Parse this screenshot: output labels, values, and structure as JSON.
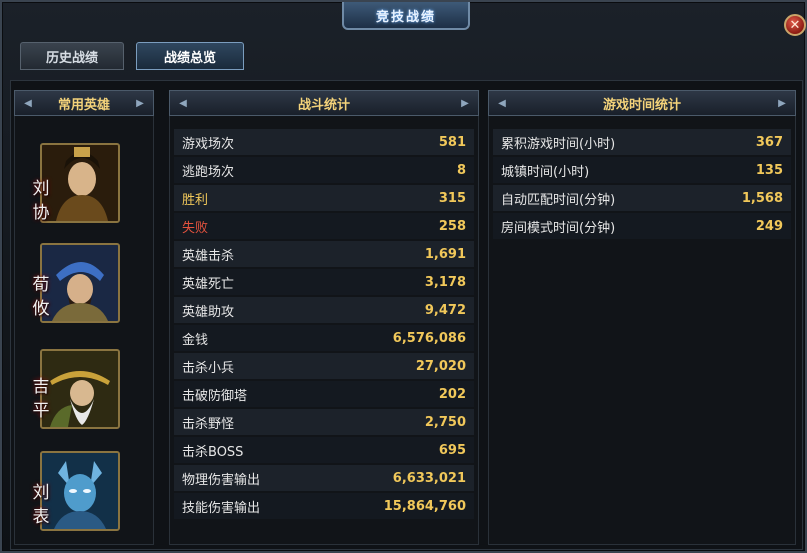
{
  "window": {
    "title": "竞技战绩",
    "close_label": "✕"
  },
  "tabs": [
    {
      "label": "历史战绩"
    },
    {
      "label": "战绩总览"
    }
  ],
  "heroes": {
    "header": "常用英雄",
    "items": [
      {
        "name": "刘协"
      },
      {
        "name": "荀攸"
      },
      {
        "name": "吉平"
      },
      {
        "name": "刘表"
      }
    ]
  },
  "battle_stats": {
    "header": "战斗统计",
    "rows": [
      {
        "label": "游戏场次",
        "value": "581"
      },
      {
        "label": "逃跑场次",
        "value": "8"
      },
      {
        "label": "胜利",
        "value": "315"
      },
      {
        "label": "失败",
        "value": "258"
      },
      {
        "label": "英雄击杀",
        "value": "1,691"
      },
      {
        "label": "英雄死亡",
        "value": "3,178"
      },
      {
        "label": "英雄助攻",
        "value": "9,472"
      },
      {
        "label": "金钱",
        "value": "6,576,086"
      },
      {
        "label": "击杀小兵",
        "value": "27,020"
      },
      {
        "label": "击破防御塔",
        "value": "202"
      },
      {
        "label": "击杀野怪",
        "value": "2,750"
      },
      {
        "label": "击杀BOSS",
        "value": "695"
      },
      {
        "label": "物理伤害输出",
        "value": "6,633,021"
      },
      {
        "label": "技能伤害输出",
        "value": "15,864,760"
      }
    ]
  },
  "time_stats": {
    "header": "游戏时间统计",
    "rows": [
      {
        "label": "累积游戏时间(小时)",
        "value": "367"
      },
      {
        "label": "城镇时间(小时)",
        "value": "135"
      },
      {
        "label": "自动匹配时间(分钟)",
        "value": "1,568"
      },
      {
        "label": "房间模式时间(分钟)",
        "value": "249"
      }
    ]
  }
}
